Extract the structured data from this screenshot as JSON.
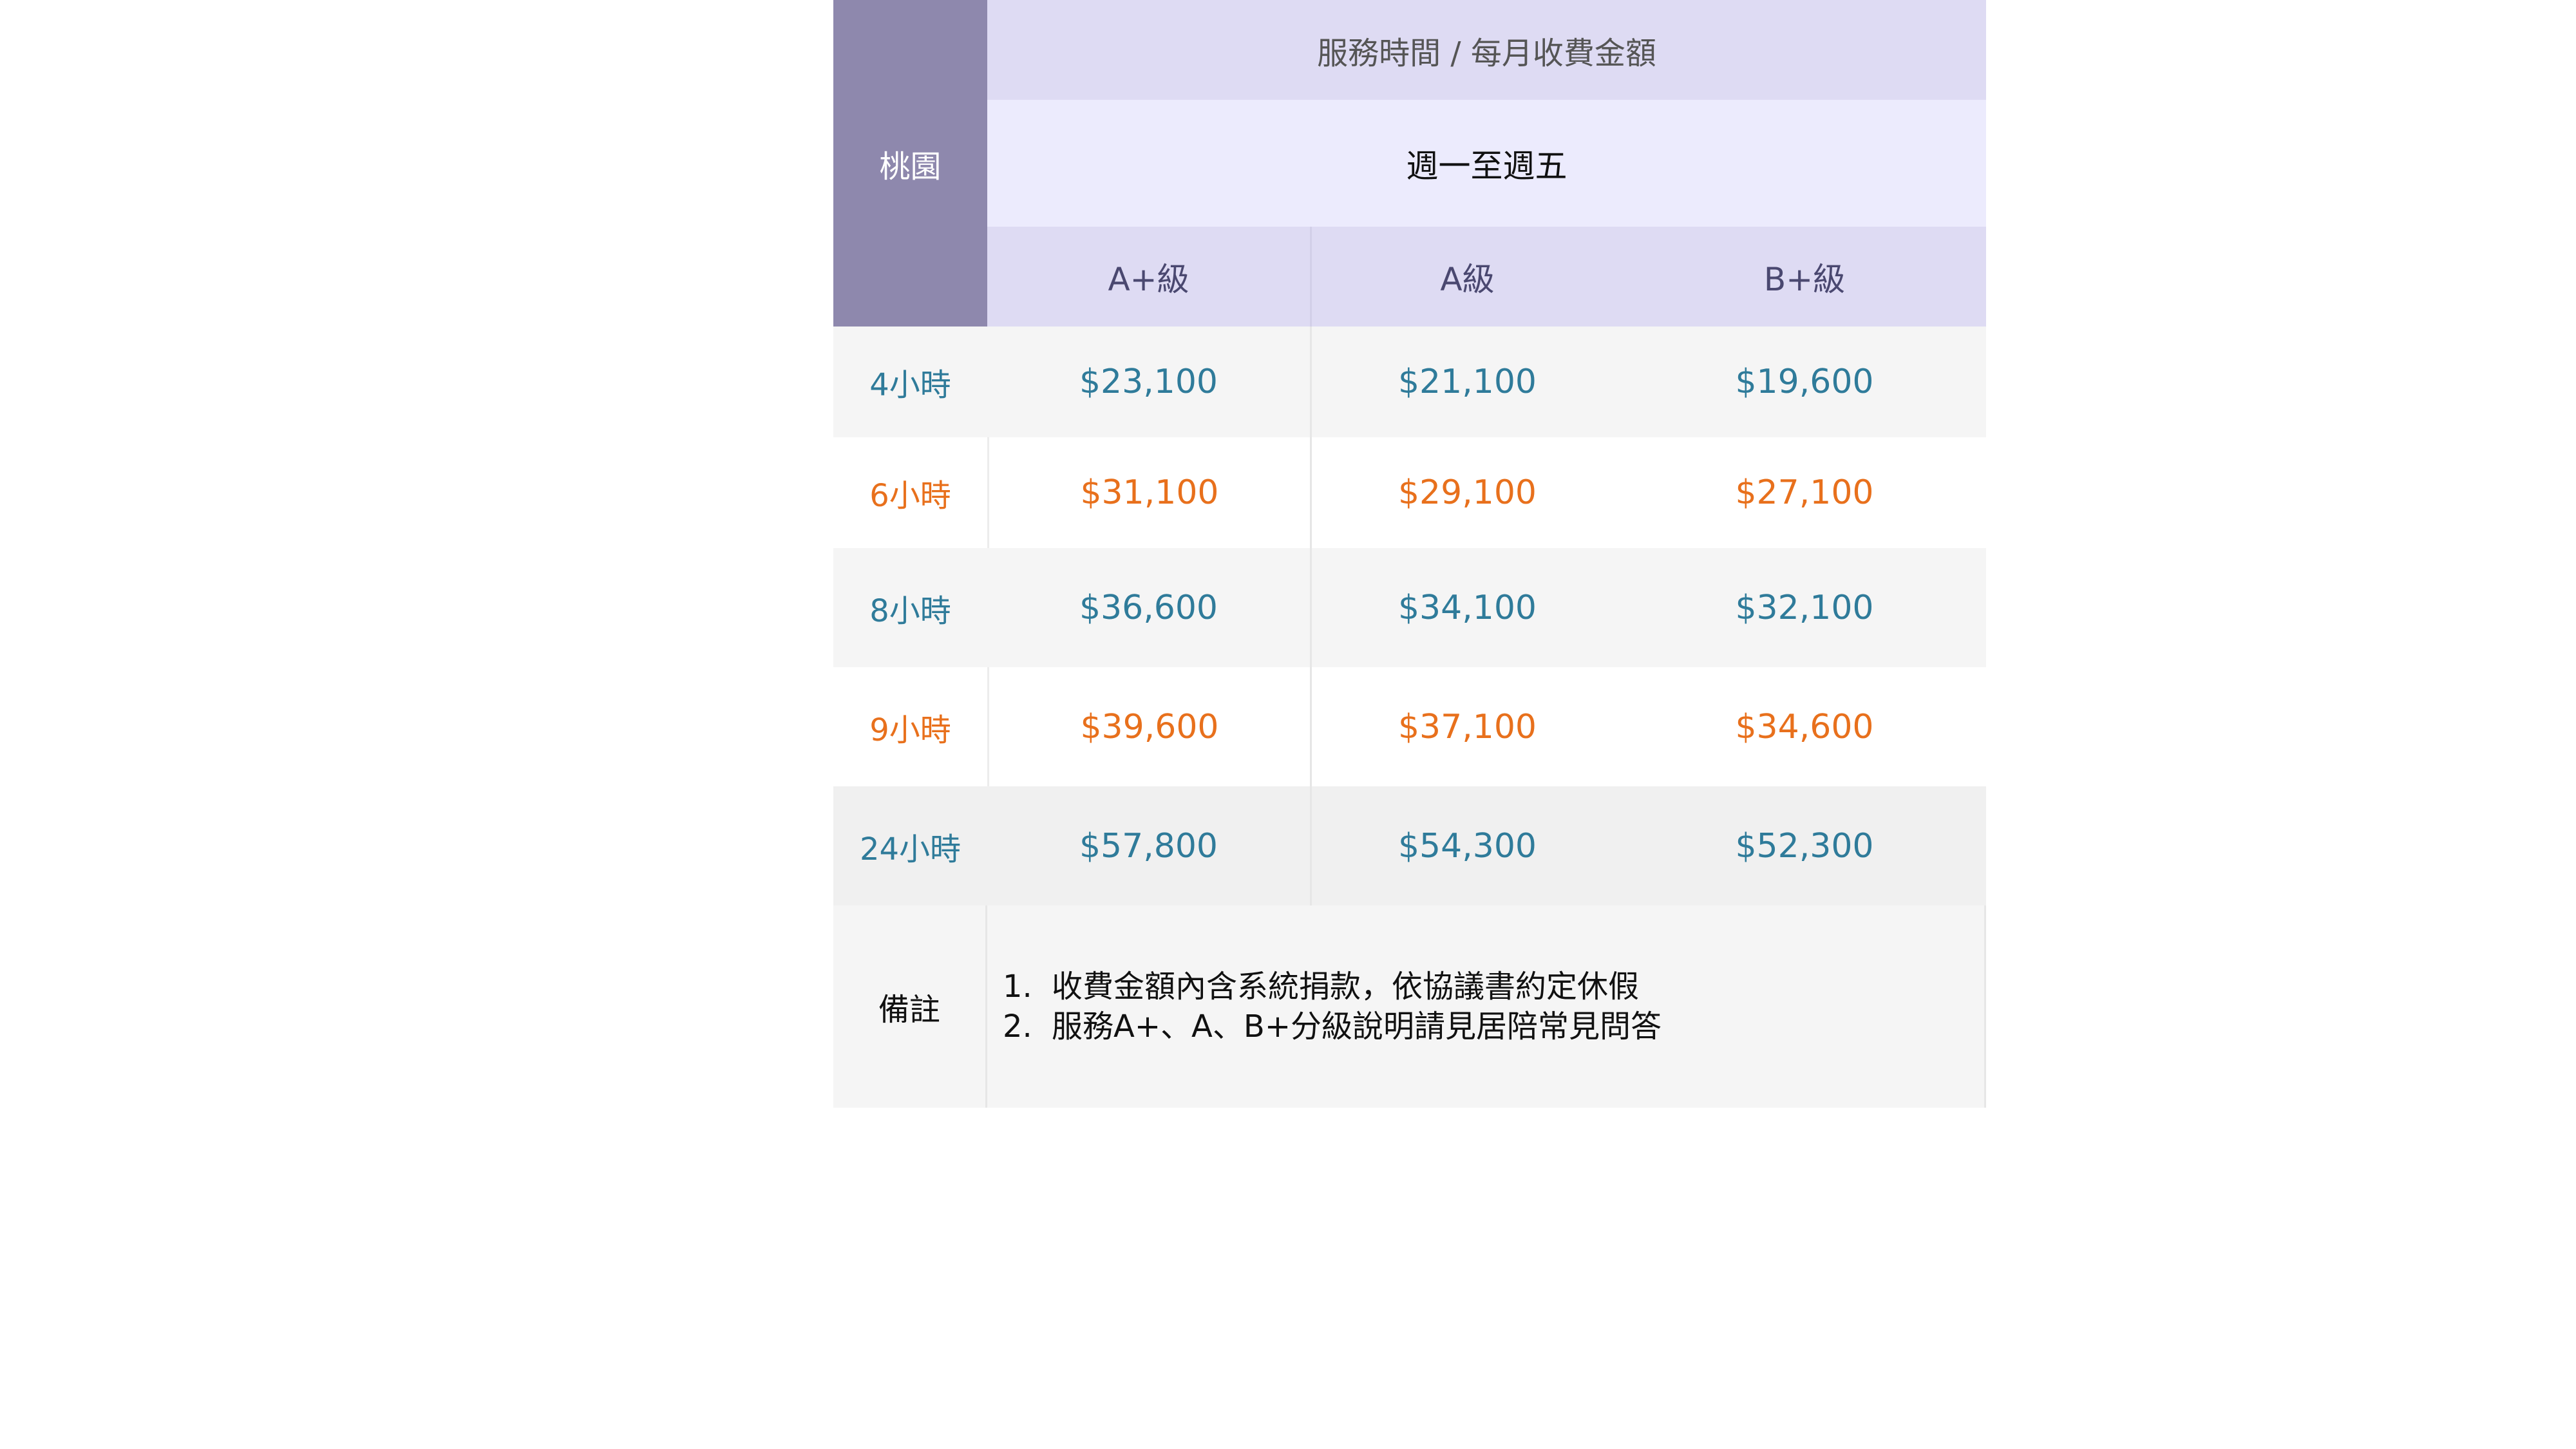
{
  "header": {
    "region": "桃園",
    "title": "服務時間 / 每月收費金額",
    "subtitle": "週一至週五",
    "grades": [
      "A+級",
      "A級",
      "B+級"
    ]
  },
  "rows": [
    {
      "label": "4小時",
      "values": [
        "$23,100",
        "$21,100",
        "$19,600"
      ]
    },
    {
      "label": "6小時",
      "values": [
        "$31,100",
        "$29,100",
        "$27,100"
      ]
    },
    {
      "label": "8小時",
      "values": [
        "$36,600",
        "$34,100",
        "$32,100"
      ]
    },
    {
      "label": "9小時",
      "values": [
        "$39,600",
        "$37,100",
        "$34,600"
      ]
    },
    {
      "label": "24小時",
      "values": [
        "$57,800",
        "$54,300",
        "$52,300"
      ]
    }
  ],
  "notes": {
    "label": "備註",
    "items": [
      {
        "num": "1.",
        "text": "收費金額內含系統捐款，依協議書約定休假"
      },
      {
        "num": "2.",
        "text": "服務A+、A、B+分級說明請見居陪常見問答"
      }
    ]
  },
  "colors": {
    "region_bg": "#8e88ad",
    "header_bg": "#dedbf3",
    "subheader_bg": "#ecebfd",
    "blue_text": "#2f7b9a",
    "orange_text": "#e8701c"
  }
}
